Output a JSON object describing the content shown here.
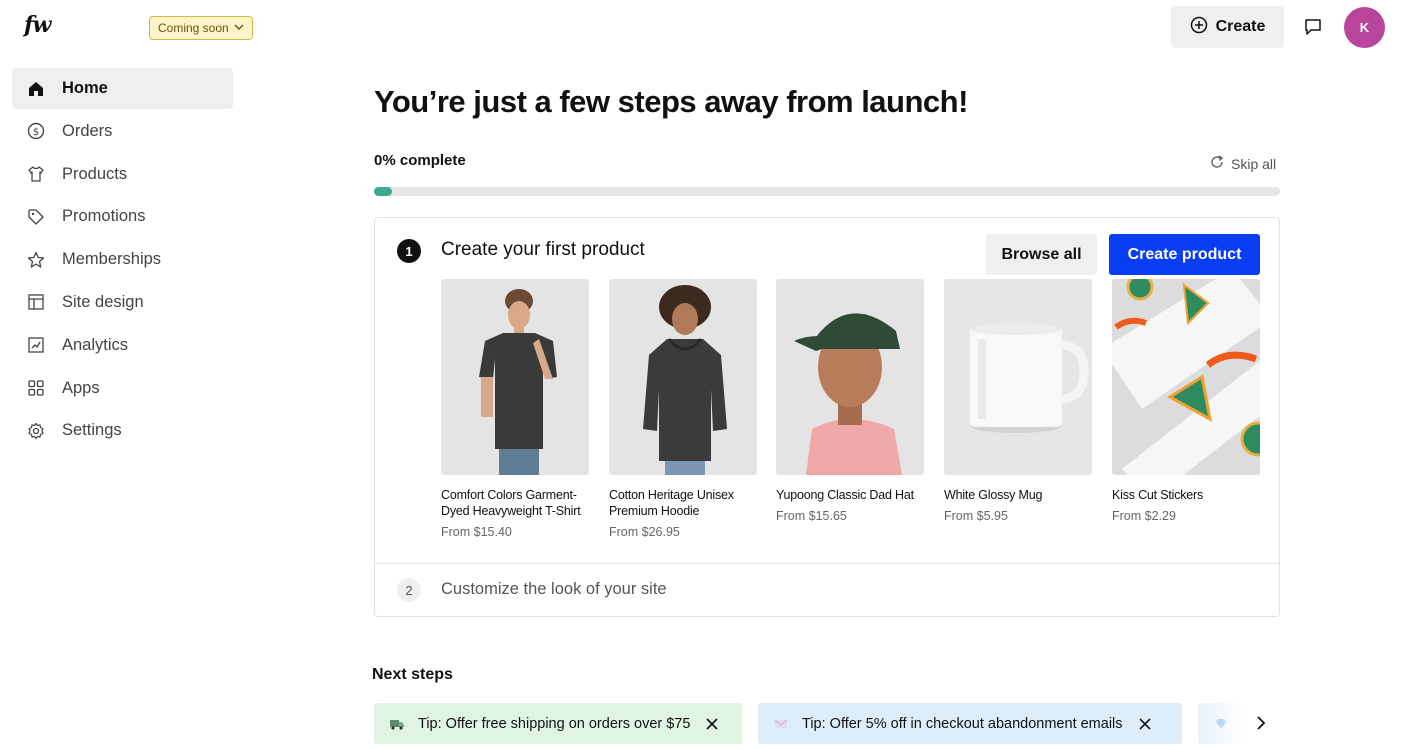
{
  "header": {
    "logo": "fw",
    "coming_soon_label": "Coming soon",
    "create_label": "Create",
    "avatar_initial": "K"
  },
  "sidebar": {
    "items": [
      {
        "label": "Home",
        "icon": "home-icon",
        "active": true
      },
      {
        "label": "Orders",
        "icon": "dollar-circle-icon"
      },
      {
        "label": "Products",
        "icon": "tshirt-icon"
      },
      {
        "label": "Promotions",
        "icon": "tag-icon"
      },
      {
        "label": "Memberships",
        "icon": "star-icon"
      },
      {
        "label": "Site design",
        "icon": "layout-icon"
      },
      {
        "label": "Analytics",
        "icon": "chart-icon"
      },
      {
        "label": "Apps",
        "icon": "apps-grid-icon"
      },
      {
        "label": "Settings",
        "icon": "gear-icon"
      }
    ]
  },
  "main": {
    "headline": "You’re just a few steps away from launch!",
    "progress_label": "0% complete",
    "progress_value": 0,
    "skip_all_label": "Skip all",
    "step1": {
      "number": "1",
      "title": "Create your first product",
      "browse_all_label": "Browse all",
      "create_product_label": "Create product",
      "products": [
        {
          "name": "Comfort Colors Garment-Dyed Heavyweight T-Shirt",
          "price": "From $15.40"
        },
        {
          "name": "Cotton Heritage Unisex Premium Hoodie",
          "price": "From $26.95"
        },
        {
          "name": "Yupoong Classic Dad Hat",
          "price": "From $15.65"
        },
        {
          "name": "White Glossy Mug",
          "price": "From $5.95"
        },
        {
          "name": "Kiss Cut Stickers",
          "price": "From $2.29"
        }
      ]
    },
    "step2": {
      "number": "2",
      "title": "Customize the look of your site"
    },
    "next_steps": {
      "title": "Next steps",
      "tips": [
        {
          "text": "Tip: Offer free shipping on orders over $75",
          "icon": "truck-icon"
        },
        {
          "text": "Tip: Offer 5% off in checkout abandonment emails",
          "icon": "envelope-icon"
        },
        {
          "text": "",
          "icon": "diamond-icon"
        }
      ]
    }
  },
  "colors": {
    "primary": "#0a3ef5",
    "progress": "#3aaa8e",
    "avatar": "#b9459c",
    "badge_bg": "#fdf3c8"
  }
}
